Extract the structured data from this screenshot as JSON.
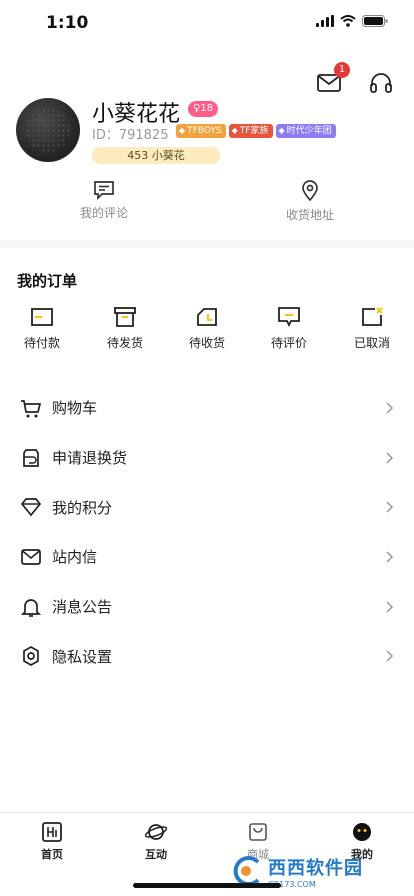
{
  "status_bar": {
    "time": "1:10",
    "icons": [
      "signal-icon",
      "wifi-icon",
      "battery-icon"
    ]
  },
  "header": {
    "message_badge": "1",
    "icons": [
      "mail-icon",
      "headset-icon"
    ]
  },
  "profile": {
    "username": "小葵花花",
    "level": "18",
    "uid": "ID：791825",
    "tags": [
      "TFBOYS",
      "TF家族",
      "时代少年团"
    ],
    "points": "453 小葵花"
  },
  "quick_links": [
    {
      "label": "我的评论",
      "icon": "comment-icon"
    },
    {
      "label": "收货地址",
      "icon": "location-icon"
    }
  ],
  "orders": {
    "title": "我的订单",
    "items": [
      {
        "label": "待付款",
        "icon": "wallet-icon"
      },
      {
        "label": "待发货",
        "icon": "box-icon"
      },
      {
        "label": "待收货",
        "icon": "truck-icon"
      },
      {
        "label": "待评价",
        "icon": "review-icon"
      },
      {
        "label": "已取消",
        "icon": "cancel-icon"
      }
    ]
  },
  "menu": [
    {
      "label": "购物车",
      "icon": "cart-icon"
    },
    {
      "label": "申请退换货",
      "icon": "return-icon"
    },
    {
      "label": "我的积分",
      "icon": "diamond-icon"
    },
    {
      "label": "站内信",
      "icon": "mail-icon"
    },
    {
      "label": "消息公告",
      "icon": "bell-icon"
    },
    {
      "label": "隐私设置",
      "icon": "gear-icon"
    }
  ],
  "tabbar": [
    {
      "label": "首页",
      "icon": "home-icon"
    },
    {
      "label": "互动",
      "icon": "planet-icon"
    },
    {
      "label": "商城",
      "icon": "bag-icon"
    },
    {
      "label": "我的",
      "icon": "smiley-icon"
    }
  ],
  "watermark": {
    "title": "西西软件园",
    "sub": "CR173.COM"
  },
  "colors": {
    "accent": "#f5c518",
    "badge": "#e53935",
    "level_pill": "#ff5c8a",
    "points_pill": "#fdebbf"
  }
}
